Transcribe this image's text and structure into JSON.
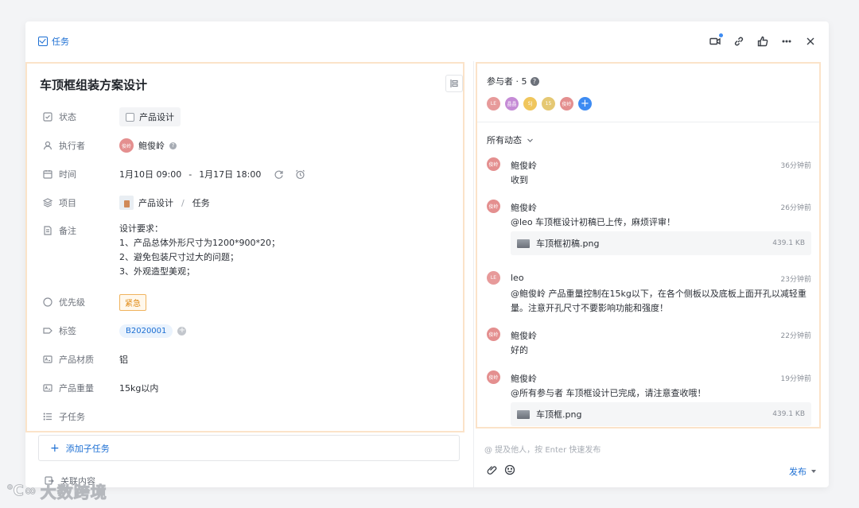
{
  "header": {
    "type_label": "任务"
  },
  "task": {
    "title": "车顶框组装方案设计",
    "fields": {
      "status": {
        "label": "状态",
        "value": "产品设计"
      },
      "assignee": {
        "label": "执行者",
        "name": "鲍俊岭",
        "avatar_text": "俊岭",
        "avatar_color": "#e48f8f"
      },
      "time": {
        "label": "时间",
        "start": "1月10日 09:00",
        "dash": "-",
        "end": "1月17日 18:00"
      },
      "project": {
        "label": "项目",
        "name": "产品设计",
        "sep": "/",
        "sub": "任务"
      },
      "note": {
        "label": "备注",
        "lines": [
          "设计要求：",
          "1、产品总体外形尺寸为1200*900*20；",
          "2、避免包装尺寸过大的问题；",
          "3、外观造型美观；"
        ]
      },
      "priority": {
        "label": "优先级",
        "value": "紧急"
      },
      "tags": {
        "label": "标签",
        "value": "B2020001"
      },
      "material": {
        "label": "产品材质",
        "value": "铝"
      },
      "weight": {
        "label": "产品重量",
        "value": "15kg以内"
      },
      "subtasks": {
        "label": "子任务"
      }
    },
    "add_subtask": "添加子任务",
    "related": "关联内容"
  },
  "participants": {
    "label": "参与者 · 5",
    "avatars": [
      {
        "text": "LE",
        "color": "#e79a9a"
      },
      {
        "text": "晶晶",
        "color": "#c58bd6"
      },
      {
        "text": "SJ",
        "color": "#f0c65c"
      },
      {
        "text": "15",
        "color": "#e5c873"
      },
      {
        "text": "俊岭",
        "color": "#e48f8f"
      }
    ],
    "add": "+"
  },
  "feed": {
    "filter_label": "所有动态",
    "items": [
      {
        "name": "鲍俊岭",
        "avatar": "俊岭",
        "color": "#e48f8f",
        "time": "36分钟前",
        "msg": "收到"
      },
      {
        "name": "鲍俊岭",
        "avatar": "俊岭",
        "color": "#e48f8f",
        "time": "26分钟前",
        "msg": "@leo 车顶框设计初稿已上传，麻烦评审！",
        "file": {
          "name": "车顶框初稿.png",
          "size": "439.1 KB"
        }
      },
      {
        "name": "leo",
        "avatar": "LE",
        "color": "#e79a9a",
        "time": "23分钟前",
        "msg": "@鲍俊岭 产品重量控制在15kg以下，在各个侧板以及底板上面开孔以减轻重量。注意开孔尺寸不要影响功能和强度！"
      },
      {
        "name": "鲍俊岭",
        "avatar": "俊岭",
        "color": "#e48f8f",
        "time": "22分钟前",
        "msg": "好的"
      },
      {
        "name": "鲍俊岭",
        "avatar": "俊岭",
        "color": "#e48f8f",
        "time": "19分钟前",
        "msg": "@所有参与者 车顶框设计已完成，请注意查收哦！",
        "file": {
          "name": "车顶框.png",
          "size": "439.1 KB"
        }
      }
    ]
  },
  "composer": {
    "placeholder": "@ 提及他人，按 Enter 快速发布",
    "publish": "发布"
  },
  "watermark": {
    "text": "大数跨境"
  }
}
